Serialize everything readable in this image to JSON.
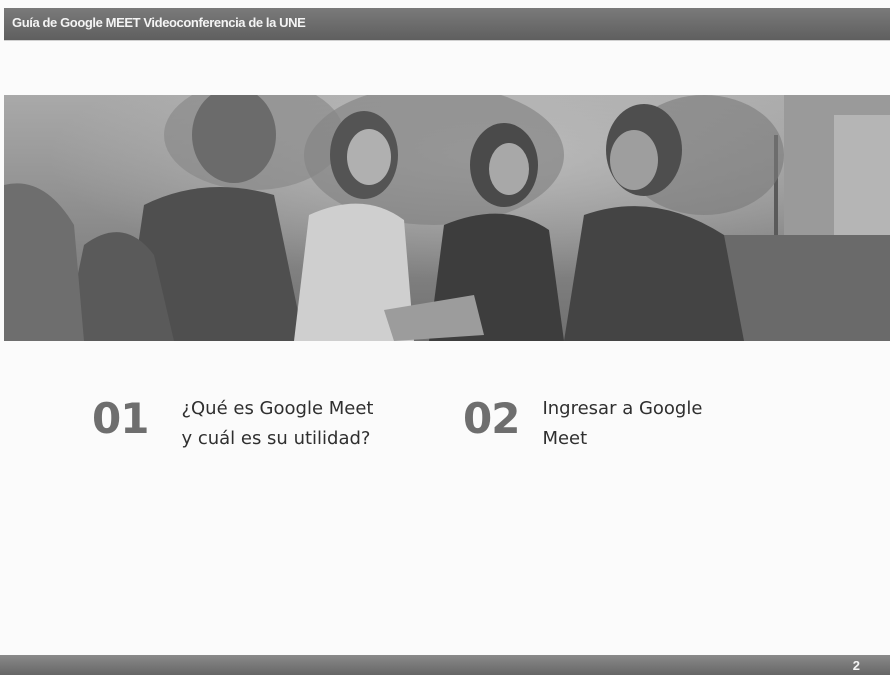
{
  "header": {
    "title": "Guía de Google MEET Videoconferencia de la UNE"
  },
  "banner": {
    "image": "group-of-students-with-tablet-photo"
  },
  "items": [
    {
      "number": "01",
      "text": "¿Qué es Google Meet y cuál es su utilidad?"
    },
    {
      "number": "02",
      "text": "Ingresar a Google Meet"
    }
  ],
  "footer": {
    "page_number": "2"
  }
}
